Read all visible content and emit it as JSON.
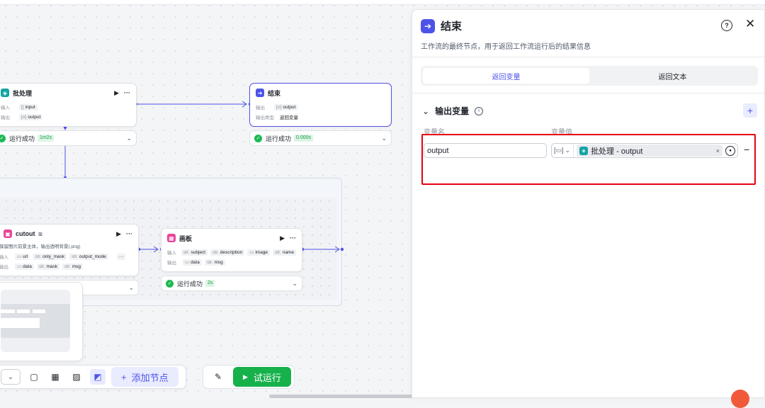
{
  "nodes": {
    "batch": {
      "title": "批处理",
      "input_label": "输入",
      "input_type": "[]",
      "input_name": "input",
      "output_label": "输出",
      "output_type": "[o]",
      "output_name": "output",
      "status": "运行成功",
      "duration": "1m2s"
    },
    "end": {
      "title": "结束",
      "output_label": "输出",
      "output_type": "[o]",
      "output_name": "output",
      "output_type_label": "输出类型",
      "output_type_value": "返回变量",
      "status": "运行成功",
      "duration": "0.000s"
    },
    "cutout": {
      "title": "cutout",
      "desc": "保留图片前景主体，输出透明背景(.png)",
      "input_label": "输入",
      "inputs": [
        {
          "type": "▭",
          "name": "url"
        },
        {
          "type": "str.",
          "name": "only_mask"
        },
        {
          "type": "str.",
          "name": "output_mode"
        }
      ],
      "more": "···",
      "output_label": "输出",
      "outputs": [
        {
          "type": "▭",
          "name": "data"
        },
        {
          "type": "str.",
          "name": "mask"
        },
        {
          "type": "str.",
          "name": "msg"
        }
      ]
    },
    "canvas": {
      "title": "画板",
      "input_label": "输入",
      "inputs": [
        {
          "type": "str.",
          "name": "subject"
        },
        {
          "type": "str.",
          "name": "description"
        },
        {
          "type": "▭",
          "name": "image"
        },
        {
          "type": "str.",
          "name": "name"
        }
      ],
      "output_label": "输出",
      "outputs": [
        {
          "type": "▭",
          "name": "data"
        },
        {
          "type": "str.",
          "name": "msg"
        }
      ],
      "status": "运行成功",
      "duration": "2s"
    }
  },
  "toolbar": {
    "add_node": "添加节点",
    "test_run": "试运行"
  },
  "panel": {
    "title": "结束",
    "description": "工作流的最终节点，用于返回工作流运行后的结果信息",
    "tabs": [
      "返回变量",
      "返回文本"
    ],
    "active_tab": 0,
    "section_title": "输出变量",
    "col_name": "变量名",
    "col_value": "变量值",
    "variable": {
      "name": "output",
      "ref": "批处理 - output"
    }
  }
}
